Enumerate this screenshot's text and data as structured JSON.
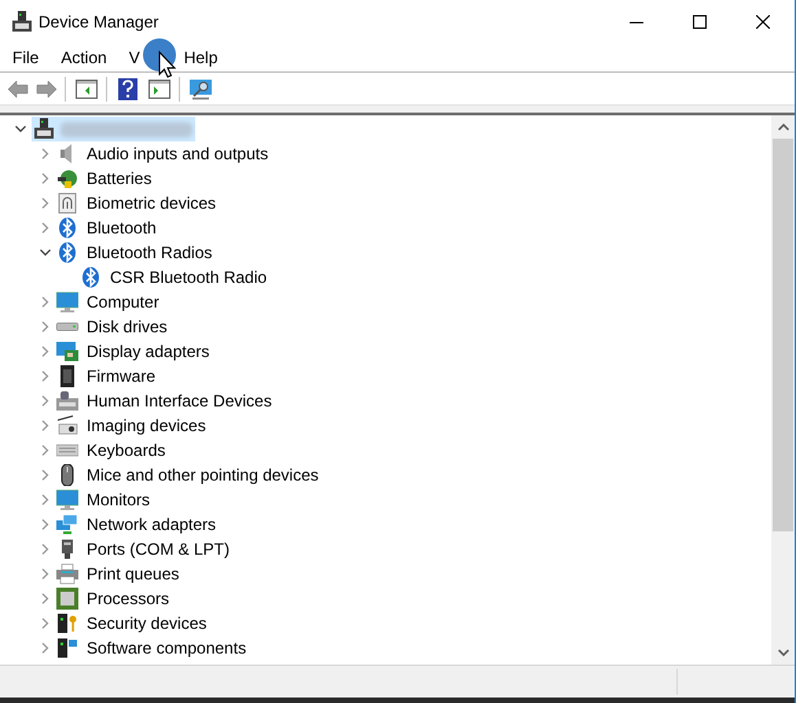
{
  "window": {
    "title": "Device Manager"
  },
  "menu": [
    {
      "label": "File"
    },
    {
      "label": "Action"
    },
    {
      "label": "V"
    },
    {
      "label": "Help"
    }
  ],
  "toolbar": [
    {
      "kind": "back",
      "disabled": true
    },
    {
      "kind": "forward",
      "disabled": true
    },
    {
      "kind": "sep"
    },
    {
      "kind": "tree",
      "disabled": false
    },
    {
      "kind": "sep"
    },
    {
      "kind": "help",
      "disabled": false
    },
    {
      "kind": "pane",
      "disabled": false
    },
    {
      "kind": "sep"
    },
    {
      "kind": "scan",
      "disabled": false
    }
  ],
  "tree": {
    "expanded": true,
    "selected": true,
    "children": [
      {
        "label": "Audio inputs and outputs",
        "kind": "audio",
        "expanded": false
      },
      {
        "label": "Batteries",
        "kind": "battery",
        "expanded": false
      },
      {
        "label": "Biometric devices",
        "kind": "fingerprint",
        "expanded": false
      },
      {
        "label": "Bluetooth",
        "kind": "bluetooth",
        "expanded": false
      },
      {
        "label": "Bluetooth Radios",
        "kind": "bluetooth",
        "expanded": true,
        "children": [
          {
            "label": "CSR Bluetooth Radio",
            "kind": "bluetooth"
          }
        ]
      },
      {
        "label": "Computer",
        "kind": "monitor",
        "expanded": false
      },
      {
        "label": "Disk drives",
        "kind": "disk",
        "expanded": false
      },
      {
        "label": "Display adapters",
        "kind": "display",
        "expanded": false
      },
      {
        "label": "Firmware",
        "kind": "chip",
        "expanded": false
      },
      {
        "label": "Human Interface Devices",
        "kind": "hid",
        "expanded": false
      },
      {
        "label": "Imaging devices",
        "kind": "camera",
        "expanded": false
      },
      {
        "label": "Keyboards",
        "kind": "keyboard",
        "expanded": false
      },
      {
        "label": "Mice and other pointing devices",
        "kind": "mouse",
        "expanded": false
      },
      {
        "label": "Monitors",
        "kind": "monitor",
        "expanded": false
      },
      {
        "label": "Network adapters",
        "kind": "network",
        "expanded": false
      },
      {
        "label": "Ports (COM & LPT)",
        "kind": "port",
        "expanded": false
      },
      {
        "label": "Print queues",
        "kind": "printer",
        "expanded": false
      },
      {
        "label": "Processors",
        "kind": "cpu",
        "expanded": false
      },
      {
        "label": "Security devices",
        "kind": "security",
        "expanded": false
      },
      {
        "label": "Software components",
        "kind": "software",
        "expanded": false
      }
    ]
  }
}
